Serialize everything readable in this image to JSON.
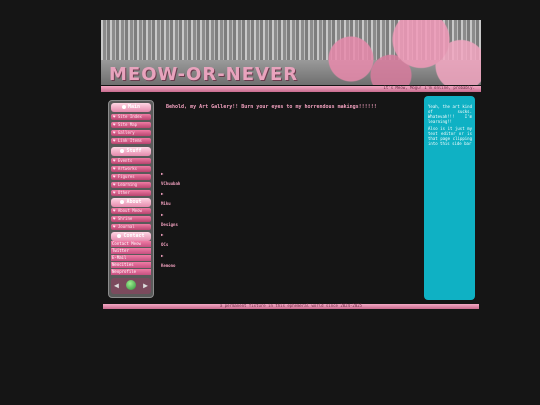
{
  "banner": {
    "logo": "MEOW-OR-NEVER",
    "tagline": "It's Meow, Mogu! I'm online, probably."
  },
  "sidebar": {
    "sections": [
      {
        "label": "Main",
        "items": [
          "Site Index",
          "Site Map",
          "Gallery",
          "Link Items"
        ]
      },
      {
        "label": "Stuff",
        "items": [
          "Events",
          "Artworks",
          "Figures",
          "Learning",
          "Other"
        ]
      },
      {
        "label": "About",
        "items": [
          "About Meow",
          "Shrine",
          "Journal"
        ]
      },
      {
        "label": "Contact",
        "items": [
          "Contact Meow",
          "Twitter",
          "E-Mail",
          "Neocities",
          "Neoprofile"
        ]
      }
    ],
    "player": {
      "prev": "◀",
      "next": "▶"
    }
  },
  "main": {
    "heading": "Behold, my Art Gallery!! Burn your eyes to my horrendous makings!!!!!!",
    "categories": [
      "VChuubah",
      "Miku",
      "Designs",
      "OCs",
      "Kemono"
    ],
    "arrow": "▶"
  },
  "side_note": {
    "p1": "Yeah, the art kind of sucks. Whatevah!!! I'm learning!!",
    "p2": "Also is it just my text editor or is that page clipping into this side bar"
  },
  "footer": {
    "text": "a permanent fixture in this ephemeral world since 2024-2025"
  },
  "colors": {
    "background": "#151515",
    "accent_pink": "#f2a1bf",
    "side_box": "#0fb1c4"
  }
}
